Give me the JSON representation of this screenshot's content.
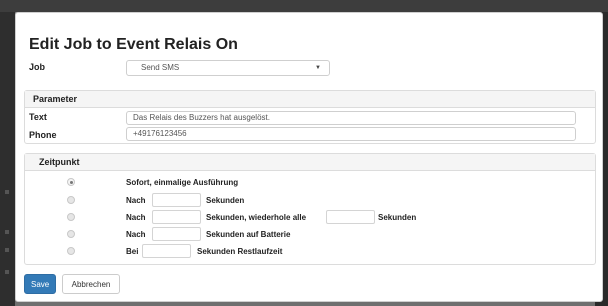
{
  "modal": {
    "title": "Edit Job to Event Relais On",
    "job_label": "Job",
    "job_select": {
      "value": "Send SMS",
      "arrow": "▼"
    }
  },
  "parameter": {
    "heading": "Parameter",
    "text_label": "Text",
    "text_value": "Das Relais des Buzzers hat ausgelöst.",
    "phone_label": "Phone",
    "phone_value": "+49176123456"
  },
  "zeitpunkt": {
    "heading": "Zeitpunkt",
    "selected_index": 0,
    "option0": {
      "text": "Sofort, einmalige Ausführung"
    },
    "option1": {
      "prefix": "Nach",
      "suffix": "Sekunden"
    },
    "option2": {
      "prefix": "Nach",
      "middle": "Sekunden, wiederhole alle",
      "suffix": "Sekunden"
    },
    "option3": {
      "prefix": "Nach",
      "suffix": "Sekunden auf Batterie"
    },
    "option4": {
      "prefix": "Bei",
      "suffix": "Sekunden Restlaufzeit"
    }
  },
  "footer": {
    "save_label": "Save",
    "cancel_label": "Abbrechen"
  },
  "colors": {
    "primary": "#337ab7",
    "panel_heading_bg": "#f5f5f5",
    "overlay": "#6f6f6f"
  }
}
